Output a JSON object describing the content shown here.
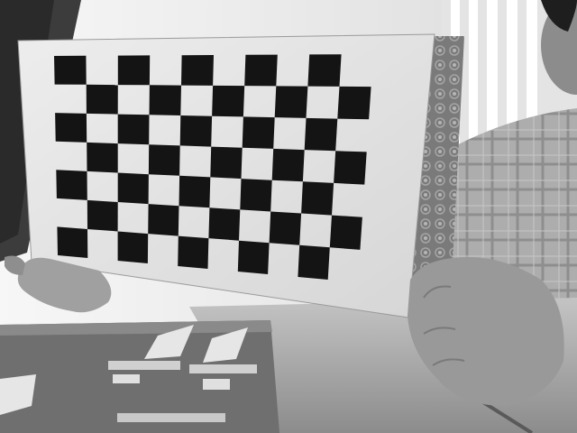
{
  "image": {
    "mode": "grayscale",
    "subject": "checkerboard-calibration-target",
    "checkerboard": {
      "columns": 10,
      "rows": 7
    },
    "colors": {
      "dark": "#141414",
      "light": "#e8e8e8",
      "wall": "#f2f2f2",
      "cover": "#8a8a8a",
      "skin": "#9a9a9a",
      "shirt": "#a8a8a8",
      "table": "#b0b0b0",
      "book": "#6f6f6f"
    }
  }
}
